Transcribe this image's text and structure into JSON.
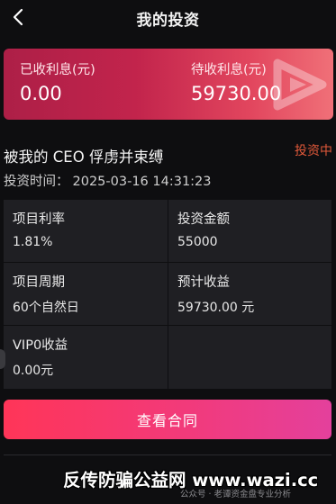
{
  "header": {
    "title": "我的投资",
    "back_icon": "chevron-left-icon"
  },
  "summary": {
    "earned_label": "已收利息(元)",
    "earned_value": "0.00",
    "pending_label": "待收利息(元)",
    "pending_value": "59730.00",
    "logo_icon": "brand-play-logo-icon"
  },
  "project": {
    "name": "被我的 CEO 俘虏并束缚",
    "status": "投资中",
    "time_label": "投资时间：",
    "time_value": "2025-03-16 14:31:23"
  },
  "details": [
    {
      "label": "项目利率",
      "value": "1.81%"
    },
    {
      "label": "投资金额",
      "value": "55000"
    },
    {
      "label": "项目周期",
      "value": "60个自然日"
    },
    {
      "label": "预计收益",
      "value": "59730.00 元"
    },
    {
      "label": "VIP0收益",
      "value": "0.00元"
    }
  ],
  "actions": {
    "view_contract": "查看合同"
  },
  "watermark": {
    "main": "反传防骗公益网 www.wazi.cc",
    "sub": "公众号 · 老谭资金盘专业分析"
  },
  "colors": {
    "background": "#0e0e10",
    "banner_start": "#ad1f47",
    "banner_end": "#f07078",
    "status_accent": "#e2593a",
    "button_start": "#ff3558",
    "button_end": "#e4409c",
    "panel": "#1f1f23"
  }
}
